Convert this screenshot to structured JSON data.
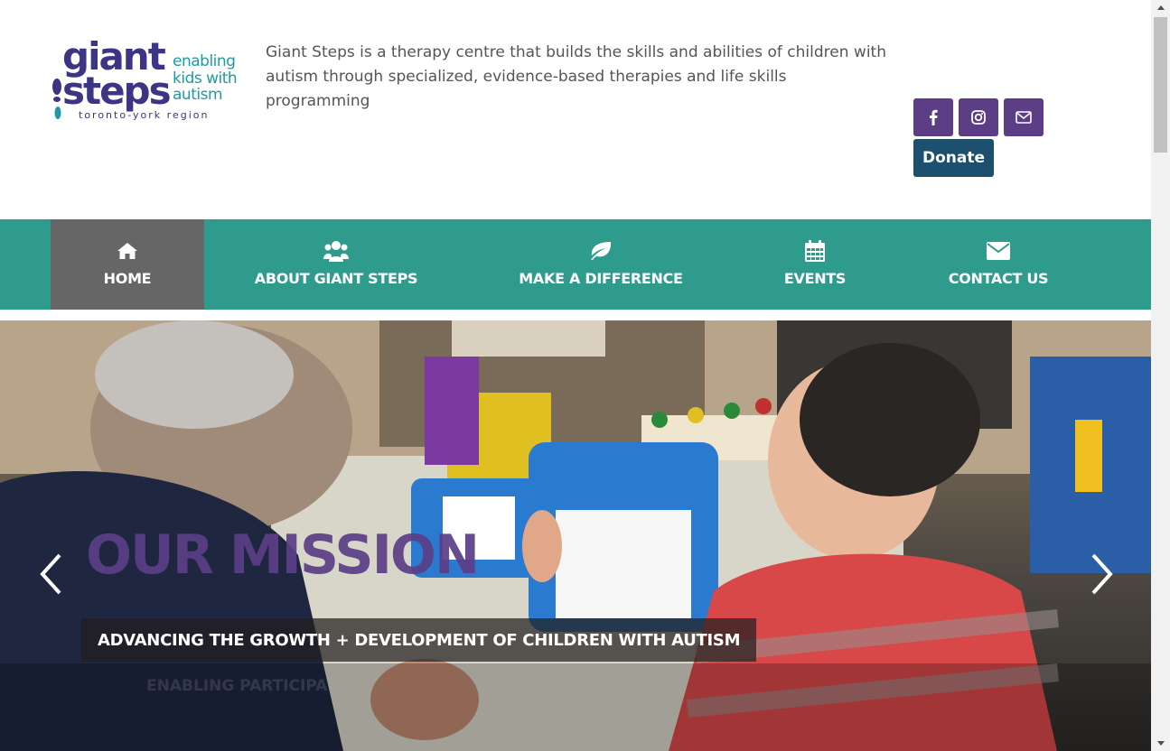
{
  "header": {
    "logo": {
      "word1": "giant",
      "word2": "steps",
      "tagline": [
        "enabling",
        "kids with",
        "autism"
      ],
      "region": "toronto-york region"
    },
    "intro": "Giant Steps is a therapy centre that builds the skills and abilities of children with autism through specialized, evidence-based therapies and life skills programming",
    "social": [
      {
        "icon": "facebook-icon"
      },
      {
        "icon": "instagram-icon"
      },
      {
        "icon": "email-icon"
      }
    ],
    "donate_label": "Donate"
  },
  "nav": {
    "items": [
      {
        "label": "HOME",
        "icon": "home-icon",
        "active": true
      },
      {
        "label": "ABOUT GIANT STEPS",
        "icon": "users-icon",
        "active": false
      },
      {
        "label": "MAKE A DIFFERENCE",
        "icon": "leaf-icon",
        "active": false
      },
      {
        "label": "EVENTS",
        "icon": "calendar-icon",
        "active": false
      },
      {
        "label": "CONTACT US",
        "icon": "envelope-icon",
        "active": false
      }
    ]
  },
  "hero": {
    "title": "OUR MISSION",
    "caption": "ADVANCING THE GROWTH + DEVELOPMENT OF CHILDREN WITH AUTISM",
    "ghost_text": "ENABLING PARTICIPA"
  },
  "colors": {
    "brand_purple": "#5b3e86",
    "brand_teal": "#2f9b8d",
    "donate_navy": "#1d4f6e",
    "nav_active": "#666666"
  }
}
